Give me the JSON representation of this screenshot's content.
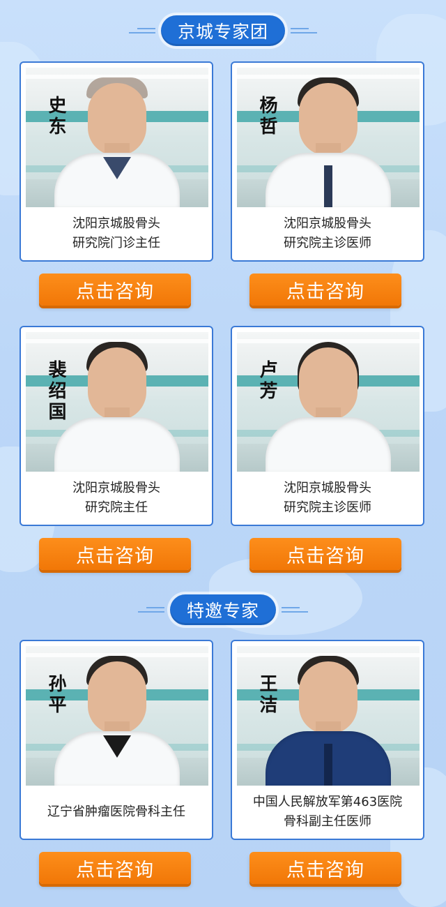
{
  "sections": [
    {
      "title": "京城专家团"
    },
    {
      "title": "特邀专家"
    }
  ],
  "experts": [
    {
      "signature": "史东",
      "desc": [
        "沈阳京城股骨头",
        "研究院门诊主任"
      ],
      "button": "点击咨询"
    },
    {
      "signature": "杨哲",
      "desc": [
        "沈阳京城股骨头",
        "研究院主诊医师"
      ],
      "button": "点击咨询"
    },
    {
      "signature": "裴绍国",
      "desc": [
        "沈阳京城股骨头",
        "研究院主任"
      ],
      "button": "点击咨询"
    },
    {
      "signature": "卢芳",
      "desc": [
        "沈阳京城股骨头",
        "研究院主诊医师"
      ],
      "button": "点击咨询"
    },
    {
      "signature": "孙平",
      "desc": [
        "辽宁省肿瘤医院骨科主任"
      ],
      "button": "点击咨询"
    },
    {
      "signature": "王洁",
      "desc": [
        "中国人民解放军第463医院",
        "骨科副主任医师"
      ],
      "button": "点击咨询"
    }
  ],
  "colors": {
    "accent": "#1f6fd6",
    "button": "#f17707",
    "card_border": "#3a79d6"
  },
  "icons": [
    "doctor-photo"
  ]
}
